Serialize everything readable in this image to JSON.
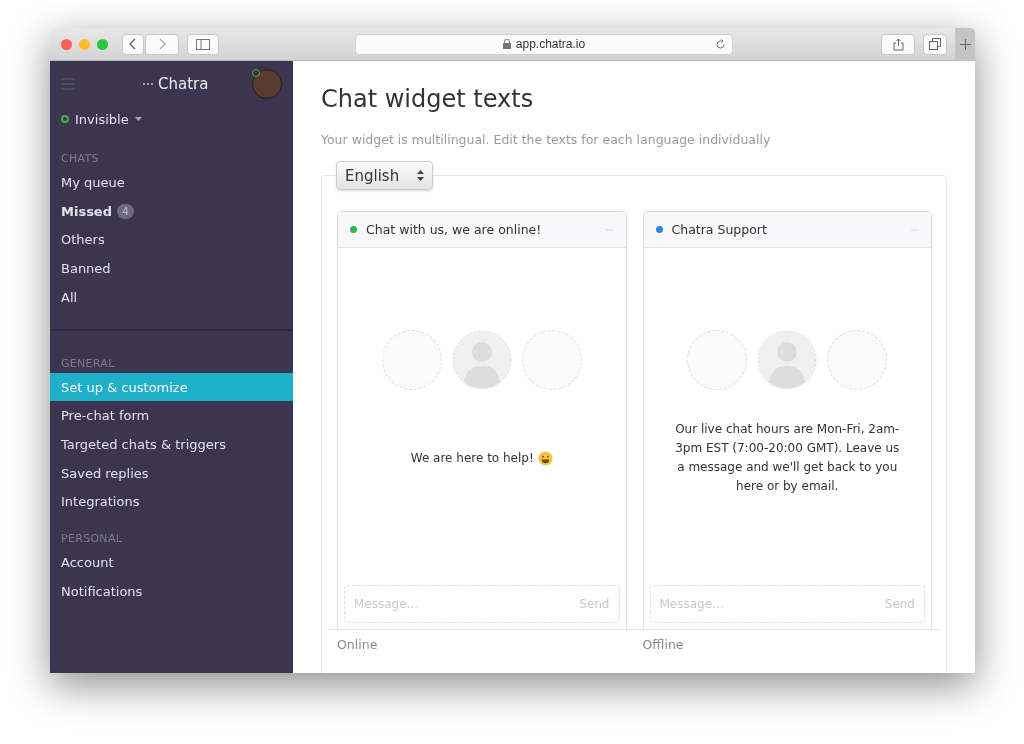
{
  "browser": {
    "address": "app.chatra.io"
  },
  "sidebar": {
    "brand": "Chatra",
    "status": {
      "label": "Invisible",
      "color": "#3fae49"
    },
    "sections": [
      {
        "heading": "CHATS",
        "items": [
          {
            "label": "My queue",
            "selected": false,
            "unread": false
          },
          {
            "label": "Missed",
            "selected": false,
            "unread": true,
            "badge": "4"
          },
          {
            "label": "Others",
            "selected": false,
            "unread": false
          },
          {
            "label": "Banned",
            "selected": false,
            "unread": false
          },
          {
            "label": "All",
            "selected": false,
            "unread": false
          }
        ]
      },
      {
        "heading": "GENERAL",
        "items": [
          {
            "label": "Set up & customize",
            "selected": true,
            "unread": false
          },
          {
            "label": "Pre-chat form",
            "selected": false,
            "unread": false
          },
          {
            "label": "Targeted chats & triggers",
            "selected": false,
            "unread": false
          },
          {
            "label": "Saved replies",
            "selected": false,
            "unread": false
          },
          {
            "label": "Integrations",
            "selected": false,
            "unread": false
          }
        ]
      },
      {
        "heading": "PERSONAL",
        "items": [
          {
            "label": "Account",
            "selected": false,
            "unread": false
          },
          {
            "label": "Notifications",
            "selected": false,
            "unread": false
          }
        ]
      }
    ]
  },
  "page": {
    "title": "Chat widget texts",
    "subtitle": "Your widget is multilingual. Edit the texts for each language individually",
    "language": "English",
    "widgets": [
      {
        "header": "Chat with us, we are online!",
        "color": "#2db84d",
        "message": "We are here to help!",
        "smiley": true,
        "placeholder": "Message...",
        "send": "Send",
        "label": "Online"
      },
      {
        "header": "Chatra Support",
        "color": "#2e86de",
        "message": "Our live chat hours are Mon-Fri, 2am-3pm EST (7:00-20:00 GMT). Leave us a message and we'll get back to you here or by email.",
        "smiley": false,
        "placeholder": "Message...",
        "send": "Send",
        "label": "Offline"
      }
    ]
  }
}
